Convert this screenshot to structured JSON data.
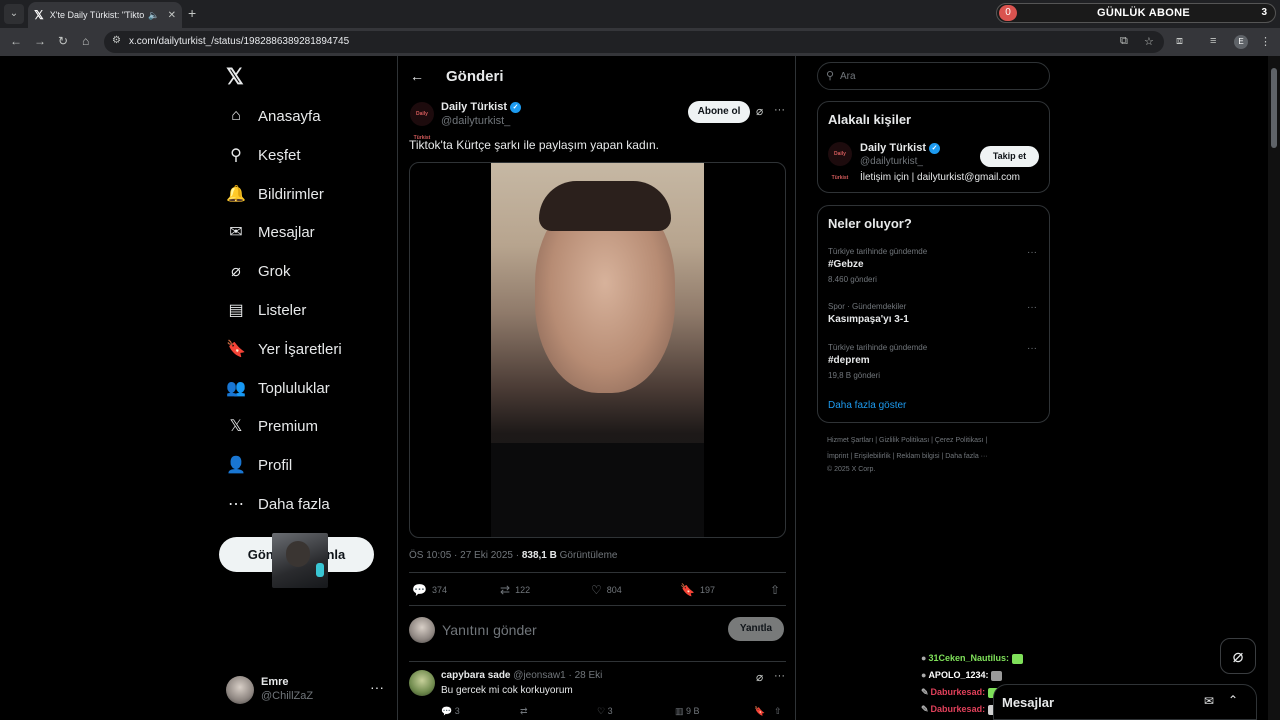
{
  "browser": {
    "tab_title": "X'te Daily Türkist: \"Tiktok'ta",
    "tab_favicon": "𝕏",
    "url": "x.com/dailyturkist_/status/1982886389281894745",
    "avatar_letter": "E"
  },
  "overlay": {
    "label": "GÜNLÜK ABONE",
    "left_count": "0",
    "right_count": "3"
  },
  "sidebar": {
    "logo": "𝕏",
    "items": [
      {
        "label": "Anasayfa",
        "icon": "⌂"
      },
      {
        "label": "Keşfet",
        "icon": "⚲"
      },
      {
        "label": "Bildirimler",
        "icon": "🔔"
      },
      {
        "label": "Mesajlar",
        "icon": "✉"
      },
      {
        "label": "Grok",
        "icon": "⌀"
      },
      {
        "label": "Listeler",
        "icon": "▤"
      },
      {
        "label": "Yer İşaretleri",
        "icon": "🔖"
      },
      {
        "label": "Topluluklar",
        "icon": "👥"
      },
      {
        "label": "Premium",
        "icon": "𝕏"
      },
      {
        "label": "Profil",
        "icon": "👤"
      },
      {
        "label": "Daha fazla",
        "icon": "⋯"
      }
    ],
    "post_button": "Gönderi yayınla",
    "account": {
      "name": "Emre",
      "handle": "@ChillZaZ"
    }
  },
  "main": {
    "header": "Gönderi",
    "tweet": {
      "author": "Daily Türkist",
      "handle": "@dailyturkist_",
      "logo_text": "Daily Türkist",
      "subscribe": "Abone ol",
      "text": "Tiktok'ta Kürtçe şarkı ile paylaşım yapan kadın.",
      "time": "ÖS 10:05 · 27 Eki 2025 · ",
      "views": "838,1 B",
      "views_label": " Görüntüleme",
      "stats": {
        "replies": "374",
        "reposts": "122",
        "likes": "804",
        "bookmarks": "197"
      }
    },
    "reply": {
      "placeholder": "Yanıtını gönder",
      "button": "Yanıtla"
    },
    "comment": {
      "name": "capybara sade",
      "meta": " @jeonsaw1 · 28 Eki",
      "text": "Bu gercek mi cok korkuyorum",
      "replies": "3",
      "likes": "3",
      "views": "9 B"
    }
  },
  "right": {
    "search_placeholder": "Ara",
    "related": {
      "title": "Alakalı kişiler",
      "name": "Daily Türkist",
      "handle": "@dailyturkist_",
      "bio": "İletişim için | dailyturkist@gmail.com",
      "follow": "Takip et"
    },
    "trends": {
      "title": "Neler oluyor?",
      "items": [
        {
          "context": "Türkiye tarihinde gündemde",
          "name": "#Gebze",
          "count": "8.460 gönderi"
        },
        {
          "context": "Spor · Gündemdekiler",
          "name": "Kasımpaşa'yı 3-1",
          "count": ""
        },
        {
          "context": "Türkiye tarihinde gündemde",
          "name": "#deprem",
          "count": "19,8 B gönderi"
        }
      ],
      "show_more": "Daha fazla göster"
    },
    "footer": {
      "line1": "Hizmet Şartları  |  Gizlilik Politikası  |  Çerez Politikası  |",
      "line2": "İmprint  |  Erişilebilirlik  |  Reklam bilgisi  |  Daha fazla ···",
      "line3": "© 2025 X Corp."
    }
  },
  "messages_drawer": {
    "title": "Mesajlar"
  },
  "chat": [
    {
      "user": "31Ceken_Nautilus:",
      "color": "#7fe05a",
      "emote": "#7fe05a"
    },
    {
      "user": "APOLO_1234:",
      "color": "#ffffff",
      "emote": "#9a9a9a"
    },
    {
      "user": "Daburkesad:",
      "color": "#e0405a",
      "emote": "#7fe05a"
    },
    {
      "user": "Daburkesad:",
      "color": "#e0405a",
      "emote": "#cfcfcf"
    }
  ]
}
